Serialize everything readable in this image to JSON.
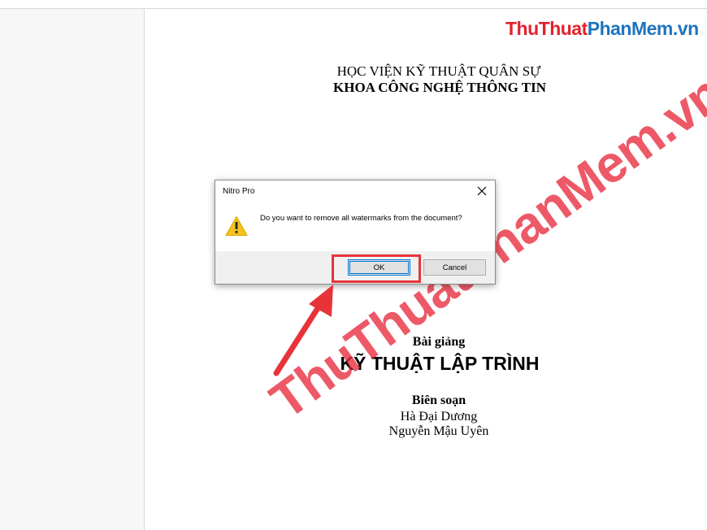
{
  "site_logo": {
    "part1": "ThuThuat",
    "part2": "PhanMem.vn"
  },
  "document": {
    "institute": "HỌC VIỆN KỸ THUẬT QUÂN SỰ",
    "faculty": "KHOA CÔNG NGHỆ THÔNG TIN",
    "lecture_label": "Bài giảng",
    "course_title": "KỸ THUẬT LẬP TRÌNH",
    "compiled_by_label": "Biên soạn",
    "author1": "Hà Đại Dương",
    "author2": "Nguyễn Mậu Uyên"
  },
  "watermark_text": "ThuThuatPhanMem.vn",
  "dialog": {
    "title": "Nitro Pro",
    "message": "Do you want to remove all watermarks from the document?",
    "ok_label": "OK",
    "cancel_label": "Cancel",
    "icon": "warning-icon"
  },
  "colors": {
    "highlight": "#e8333a",
    "arrow": "#e8333a",
    "watermark": "#e82a3c",
    "logo_red": "#e2222d",
    "logo_blue": "#1e73be",
    "focus_blue": "#0078d7"
  }
}
